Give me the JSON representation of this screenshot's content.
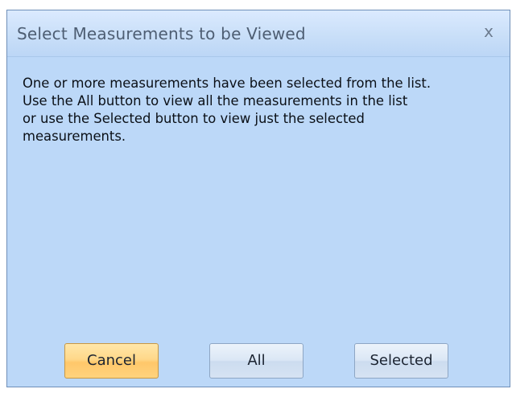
{
  "dialog": {
    "title": "Select Measurements to be Viewed",
    "close_glyph": "x",
    "message": "One or more measurements have been selected from the list.\nUse the All button to view all the measurements in the list\nor use the Selected button to view just the selected\nmeasurements."
  },
  "buttons": {
    "cancel_label": "Cancel",
    "all_label": "All",
    "selected_label": "Selected"
  }
}
